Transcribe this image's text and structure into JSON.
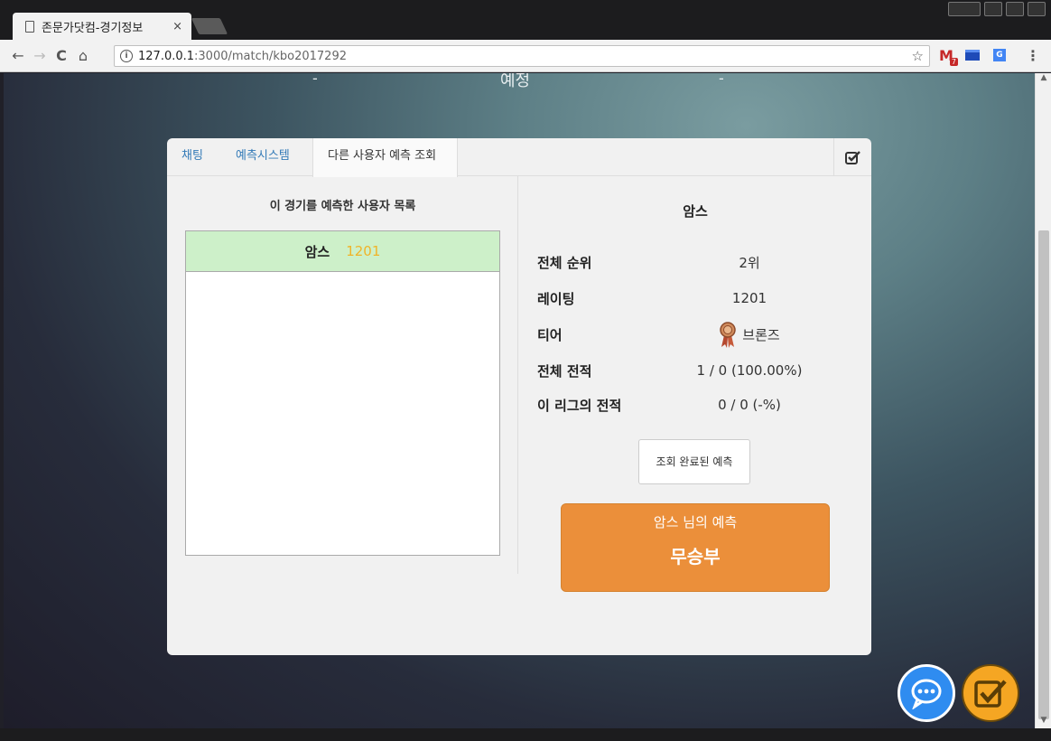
{
  "browser": {
    "tab_title": "존문가닷컴-경기정보",
    "tab_close": "×",
    "url_host": "127.0.0.1",
    "url_path": ":3000/match/kbo2017292",
    "gmail_badge": "7",
    "back_icon": "←",
    "forward_icon": "→",
    "reload_icon": "C",
    "home_icon": "⌂",
    "star_icon": "☆",
    "menu_icon": "⋮"
  },
  "page": {
    "top_status": "예정",
    "top_dash_left": "-",
    "top_dash_right": "-"
  },
  "panel": {
    "tabs": [
      "채팅",
      "예측시스템",
      "다른 사용자 예측 조회"
    ],
    "list_title": "이 경기를 예측한 사용자 목록",
    "users": [
      {
        "name": "암스",
        "rating": "1201"
      }
    ],
    "detail": {
      "name": "암스",
      "stats": [
        {
          "label": "전체 순위",
          "value": "2위"
        },
        {
          "label": "레이팅",
          "value": "1201"
        },
        {
          "label": "티어",
          "value": "브론즈"
        },
        {
          "label": "전체 전적",
          "value": "1 / 0 (100.00%)"
        },
        {
          "label": "이 리그의 전적",
          "value": "0 / 0 (-%)"
        }
      ],
      "done_button": "조회 완료된 예측",
      "prediction_caption": "암스 님의 예측",
      "prediction_result": "무승부"
    }
  },
  "colors": {
    "prediction_bg": "#eb8f3a",
    "selected_row_bg": "#cdf0c9",
    "rating_color": "#f0b429",
    "chat_fab": "#2f8cf0",
    "check_fab": "#f5a623"
  },
  "icons": {
    "tier": "bronze-medal-icon",
    "chat_fab": "speech-bubble-icon",
    "check_fab": "checkbox-icon"
  }
}
